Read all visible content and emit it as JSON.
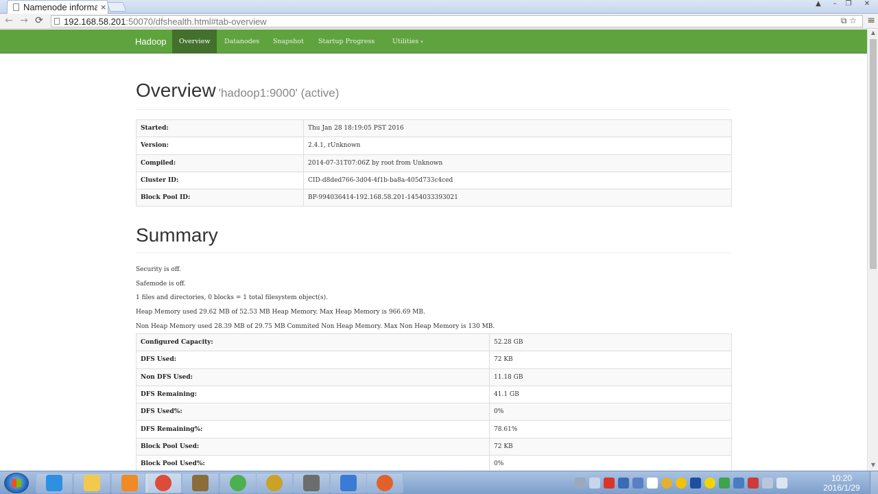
{
  "browser": {
    "tab_title": "Namenode informa",
    "tab_close": "×",
    "url_host": "192.168.58.201",
    "url_rest": ":50070/dfshealth.html#tab-overview",
    "back": "←",
    "forward": "→",
    "reload": "⟳",
    "url_icons": "⧉ ☆",
    "menu": "≡"
  },
  "navbar": {
    "brand": "Hadoop",
    "items": [
      {
        "label": "Overview",
        "active": true
      },
      {
        "label": "Datanodes"
      },
      {
        "label": "Snapshot"
      },
      {
        "label": "Startup Progress"
      },
      {
        "label": "Utilities"
      }
    ],
    "caret": "▾"
  },
  "overview": {
    "title": "Overview",
    "subtitle": "'hadoop1:9000' (active)",
    "rows": [
      {
        "key": "Started:",
        "value": "Thu Jan 28 18:19:05 PST 2016"
      },
      {
        "key": "Version:",
        "value": "2.4.1, rUnknown"
      },
      {
        "key": "Compiled:",
        "value": "2014-07-31T07:06Z by root from Unknown"
      },
      {
        "key": "Cluster ID:",
        "value": "CID-d8ded766-3d04-4f1b-ba8a-405d733c4ced"
      },
      {
        "key": "Block Pool ID:",
        "value": "BP-994036414-192.168.58.201-1454033393021"
      }
    ]
  },
  "summary": {
    "title": "Summary",
    "lines": [
      "Security is off.",
      "Safemode is off.",
      "1 files and directories, 0 blocks = 1 total filesystem object(s).",
      "Heap Memory used 29.62 MB of 52.53 MB Heap Memory. Max Heap Memory is 966.69 MB.",
      "Non Heap Memory used 28.39 MB of 29.75 MB Commited Non Heap Memory. Max Non Heap Memory is 130 MB."
    ],
    "rows": [
      {
        "key": "Configured Capacity:",
        "value": "52.28 GB"
      },
      {
        "key": "DFS Used:",
        "value": "72 KB"
      },
      {
        "key": "Non DFS Used:",
        "value": "11.18 GB"
      },
      {
        "key": "DFS Remaining:",
        "value": "41.1 GB"
      },
      {
        "key": "DFS Used%:",
        "value": "0%"
      },
      {
        "key": "DFS Remaining%:",
        "value": "78.61%"
      },
      {
        "key": "Block Pool Used:",
        "value": "72 KB"
      },
      {
        "key": "Block Pool Used%:",
        "value": "0%"
      }
    ]
  },
  "taskbar": {
    "time": "10:20",
    "date": "2016/1/29",
    "apps": [
      {
        "name": "internet-explorer",
        "color": "#2f8fe0"
      },
      {
        "name": "file-explorer",
        "color": "#f2c94c"
      },
      {
        "name": "media-player",
        "color": "#f08a24"
      },
      {
        "name": "chrome",
        "color": "#dd4b39"
      },
      {
        "name": "installer",
        "color": "#8a6d3b"
      },
      {
        "name": "green-app",
        "color": "#4caf50"
      },
      {
        "name": "e-app",
        "color": "#c9a227"
      },
      {
        "name": "screen-tool",
        "color": "#6d6d6d"
      },
      {
        "name": "vm-app",
        "color": "#3a7bd5"
      },
      {
        "name": "mascot-app",
        "color": "#e0622a"
      }
    ]
  }
}
